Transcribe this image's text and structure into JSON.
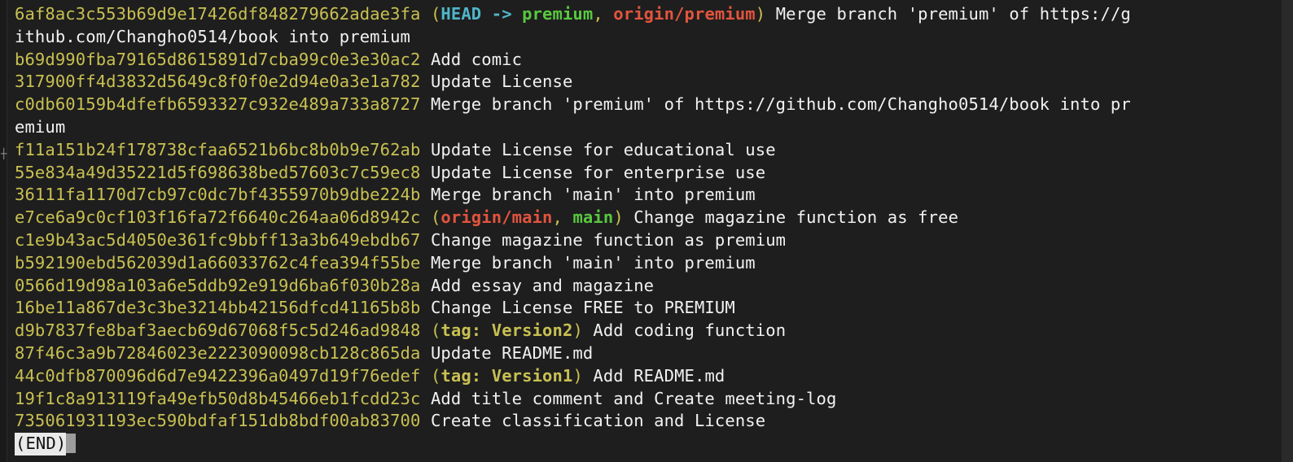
{
  "terminal": {
    "lines": [
      {
        "hash": "6af8ac3c553b69d9e17426df848279662adae3fa",
        "refs_open": "(",
        "head": "HEAD ->",
        "branch_local": "premium",
        "sep1": ", ",
        "branch_remote": "origin/premium",
        "refs_close": ")",
        "msg_part1": "Merge branch 'premium' of https://g",
        "msg_part2": "ithub.com/Changho0514/book into premium"
      },
      {
        "hash": "b69d990fba79165d8615891d7cba99c0e3e30ac2",
        "msg": "Add comic"
      },
      {
        "hash": "317900ff4d3832d5649c8f0f0e2d94e0a3e1a782",
        "msg": "Update License"
      },
      {
        "hash": "c0db60159b4dfefb6593327c932e489a733a8727",
        "msg_part1": "Merge branch 'premium' of https://github.com/Changho0514/book into pr",
        "msg_part2": "emium"
      },
      {
        "hash": "f11a151b24f178738cfaa6521b6bc8b0b9e762ab",
        "msg": "Update License for educational use"
      },
      {
        "hash": "55e834a49d35221d5f698638bed57603c7c59ec8",
        "msg": "Update License for enterprise use"
      },
      {
        "hash": "36111fa1170d7cb97c0dc7bf4355970b9dbe224b",
        "msg": "Merge branch 'main' into premium"
      },
      {
        "hash": "e7ce6a9c0cf103f16fa72f6640c264aa06d8942c",
        "refs_open": "(",
        "branch_remote": "origin/main",
        "sep1": ", ",
        "branch_local": "main",
        "refs_close": ")",
        "msg": "Change magazine function as free"
      },
      {
        "hash": "c1e9b43ac5d4050e361fc9bbff13a3b649ebdb67",
        "msg": "Change magazine function as premium"
      },
      {
        "hash": "b592190ebd562039d1a66033762c4fea394f55be",
        "msg": "Merge branch 'main' into premium"
      },
      {
        "hash": "0566d19d98a103a6e5ddb92e919d6ba6f030b28a",
        "msg": "Add essay and magazine"
      },
      {
        "hash": "16be11a867de3c3be3214bb42156dfcd41165b8b",
        "msg": "Change License FREE to PREMIUM"
      },
      {
        "hash": "d9b7837fe8baf3aecb69d67068f5c5d246ad9848",
        "refs_open": "(",
        "tag": "tag: Version2",
        "refs_close": ")",
        "msg": "Add coding function"
      },
      {
        "hash": "87f46c3a9b72846023e2223090098cb128c865da",
        "msg": "Update README.md"
      },
      {
        "hash": "44c0dfb870096d6d7e9422396a0497d19f76edef",
        "refs_open": "(",
        "tag": "tag: Version1",
        "refs_close": ")",
        "msg": "Add README.md"
      },
      {
        "hash": "19f1c8a913119fa49efb50d8b45466eb1fcdd23c",
        "msg": "Add title comment and Create meeting-log"
      },
      {
        "hash": "735061931193ec590bdfaf151db8bdf00ab83700",
        "msg": "Create classification and License"
      }
    ],
    "pager_end": "(END)"
  },
  "colors": {
    "background": "#1e1e1e",
    "hash": "#c8c052",
    "head": "#4fb6c9",
    "local_branch": "#58c840",
    "remote_branch": "#e2543e",
    "text": "#f2f2f2"
  }
}
